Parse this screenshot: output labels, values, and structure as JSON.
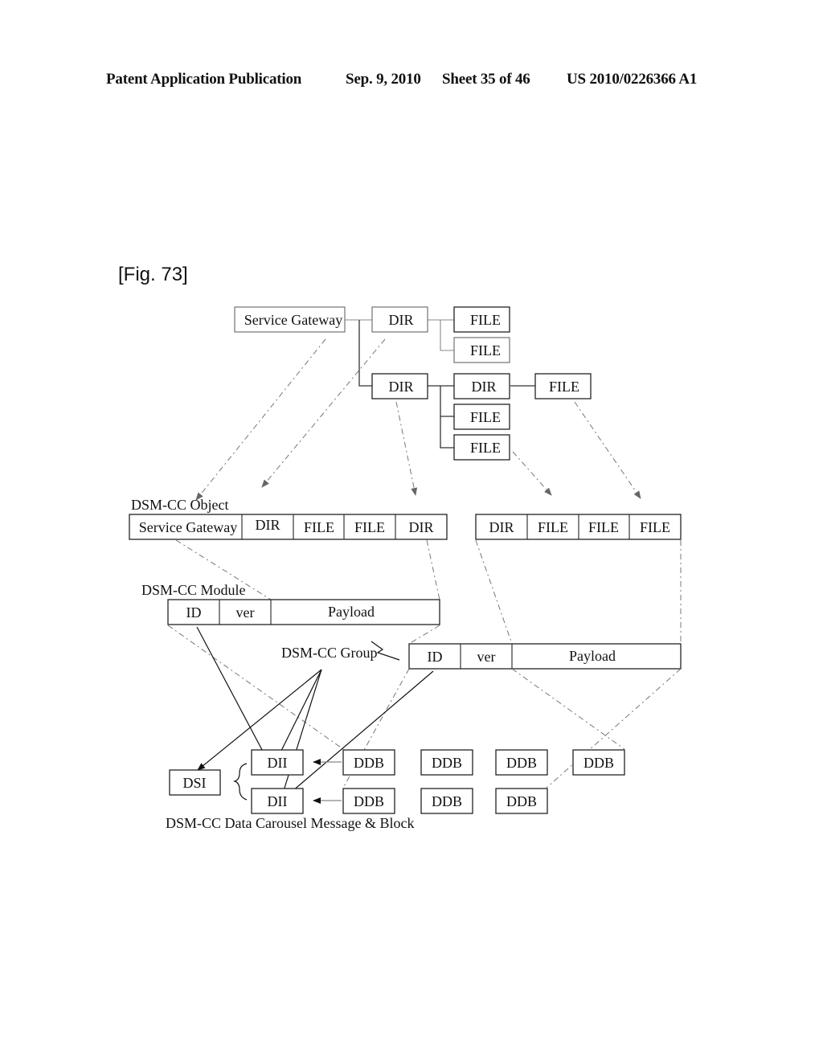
{
  "header": {
    "publication": "Patent Application Publication",
    "date": "Sep. 9, 2010",
    "sheet": "Sheet 35 of 46",
    "number": "US 2010/0226366 A1"
  },
  "figure_label": "[Fig. 73]",
  "tree": {
    "service_gateway": "Service Gateway",
    "dir_1": "DIR",
    "dir_1_files": [
      "FILE",
      "FILE"
    ],
    "dir_2": "DIR",
    "dir_2_children": {
      "dir": "DIR",
      "dir_file": "FILE",
      "files": [
        "FILE",
        "FILE"
      ]
    }
  },
  "object": {
    "label": "DSM-CC Object",
    "row_1": [
      "Service Gateway",
      "DIR",
      "FILE",
      "FILE",
      "DIR"
    ],
    "row_2": [
      "DIR",
      "FILE",
      "FILE",
      "FILE"
    ]
  },
  "module": {
    "label": "DSM-CC Module",
    "fields_1": [
      "ID",
      "ver",
      "Payload"
    ],
    "fields_2": [
      "ID",
      "ver",
      "Payload"
    ]
  },
  "group": {
    "label": "DSM-CC Group"
  },
  "carousel": {
    "label": "DSM-CC Data Carousel Message & Block",
    "dsi": "DSI",
    "dii": [
      "DII",
      "DII"
    ],
    "ddb_row_1": [
      "DDB",
      "DDB",
      "DDB",
      "DDB"
    ],
    "ddb_row_2": [
      "DDB",
      "DDB",
      "DDB"
    ]
  }
}
